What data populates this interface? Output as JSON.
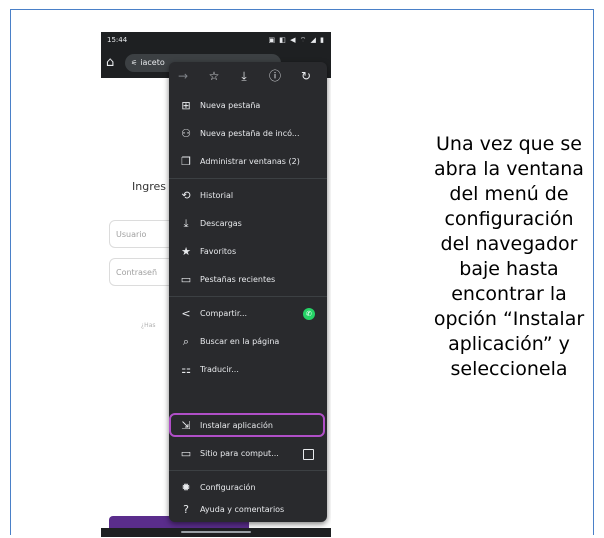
{
  "status_bar": {
    "time": "15:44",
    "icons_text": "▣ ◧ ◀ ⌔ ◢ ▮"
  },
  "browser": {
    "url_text": "iaceto",
    "toolbar_icons": [
      "arrow-forward-icon",
      "star-icon",
      "download-icon",
      "info-icon",
      "refresh-icon"
    ]
  },
  "page": {
    "login_heading": "Ingres",
    "username_placeholder": "Usuario",
    "password_placeholder": "Contraseñ",
    "forgot_text": "¿Has"
  },
  "menu": {
    "items": [
      {
        "label": "Nueva pestaña",
        "icon": "new-tab-icon"
      },
      {
        "label": "Nueva pestaña de incó...",
        "icon": "incognito-icon"
      },
      {
        "label": "Administrar ventanas (2)",
        "icon": "windows-icon"
      },
      {
        "label": "Historial",
        "icon": "history-icon"
      },
      {
        "label": "Descargas",
        "icon": "downloads-icon"
      },
      {
        "label": "Favoritos",
        "icon": "star-icon"
      },
      {
        "label": "Pestañas recientes",
        "icon": "recent-tabs-icon"
      },
      {
        "label": "Compartir...",
        "icon": "share-icon"
      },
      {
        "label": "Buscar en la página",
        "icon": "find-in-page-icon"
      },
      {
        "label": "Traducir...",
        "icon": "translate-icon"
      },
      {
        "label": "Instalar aplicación",
        "icon": "install-app-icon"
      },
      {
        "label": "Sitio para comput...",
        "icon": "desktop-site-icon"
      },
      {
        "label": "Configuración",
        "icon": "settings-icon"
      },
      {
        "label": "Ayuda y comentarios",
        "icon": "help-icon"
      }
    ]
  },
  "instruction": {
    "lines": [
      "Una vez que se",
      "abra la ventana",
      "del menú de",
      "configuración",
      "del navegador",
      "baje hasta",
      "encontrar la",
      "opción “Instalar",
      "aplicación” y",
      "seleccionela"
    ]
  },
  "colors": {
    "menu_bg": "#292a2d",
    "highlight": "#b04fc7",
    "frame_border": "#4a80c8",
    "login_button": "#5a2d8c",
    "whatsapp": "#25d366"
  }
}
